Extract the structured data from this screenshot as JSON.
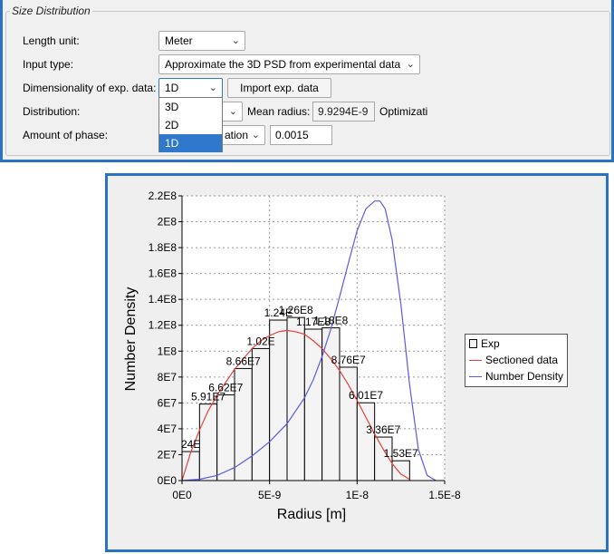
{
  "size_distribution": {
    "group_title": "Size Distribution",
    "length_unit": {
      "label": "Length unit:",
      "value": "Meter"
    },
    "input_type": {
      "label": "Input type:",
      "value": "Approximate the 3D PSD from experimental data"
    },
    "dimensionality": {
      "label": "Dimensionality of exp. data:",
      "value": "1D",
      "options": [
        "3D",
        "2D",
        "1D"
      ],
      "selected_index": 2
    },
    "import_button": "Import exp. data",
    "distribution": {
      "label": "Distribution:"
    },
    "mean_radius": {
      "label": "Mean radius:",
      "value": "9.9294E-9"
    },
    "optimization_label": "Optimizati",
    "amount_of_phase": {
      "label": "Amount of phase:",
      "mode_value": "ation",
      "value": "0.0015"
    }
  },
  "chart_data": {
    "type": "bar",
    "xlabel": "Radius [m]",
    "ylabel": "Number Density",
    "xlim": [
      0,
      1.5e-08
    ],
    "ylim": [
      0,
      220000000.0
    ],
    "x_ticks": [
      0,
      5e-09,
      1e-08,
      1.5e-08
    ],
    "x_tick_labels": [
      "0E0",
      "5E-9",
      "1E-8",
      "1.5E-8"
    ],
    "y_ticks": [
      0,
      20000000.0,
      40000000.0,
      60000000.0,
      80000000.0,
      100000000.0,
      120000000.0,
      140000000.0,
      160000000.0,
      180000000.0,
      200000000.0,
      220000000.0
    ],
    "y_tick_labels": [
      "0E0",
      "2E7",
      "4E7",
      "6E7",
      "8E7",
      "1E8",
      "1.2E8",
      "1.4E8",
      "1.6E8",
      "1.8E8",
      "2E8",
      "2.2E8"
    ],
    "grid": true,
    "legend_position": "right",
    "bars": {
      "name": "Exp",
      "bin_edges": [
        0,
        1e-09,
        2e-09,
        3e-09,
        4e-09,
        5e-09,
        6e-09,
        7e-09,
        8e-09,
        9e-09,
        1e-08,
        1.1e-08,
        1.2e-08,
        1.3e-08
      ],
      "values": [
        22400000.0,
        59100000.0,
        66200000.0,
        86600000.0,
        102000000.0,
        124000000.0,
        126000000.0,
        117000000.0,
        118000000.0,
        87600000.0,
        60100000.0,
        33600000.0,
        15300000.0
      ],
      "labels": [
        "24E",
        "5.91E7",
        "6.62E7",
        "8.66E7",
        "1.02E",
        "1.24E",
        "1.26E8",
        "1.17E8",
        "1.18E8",
        "8.76E7",
        "6.01E7",
        "3.36E7",
        "1.53E7"
      ]
    },
    "series": [
      {
        "name": "Sectioned data",
        "color": "#e8403c",
        "x": [
          0,
          5e-10,
          1e-09,
          1.5e-09,
          2e-09,
          2.5e-09,
          3e-09,
          3.5e-09,
          4e-09,
          4.5e-09,
          5e-09,
          5.5e-09,
          6e-09,
          6.5e-09,
          7e-09,
          7.5e-09,
          8e-09,
          8.5e-09,
          9e-09,
          9.5e-09,
          1e-08,
          1.05e-08,
          1.1e-08,
          1.15e-08,
          1.2e-08,
          1.25e-08,
          1.3e-08
        ],
        "y": [
          0,
          22000000.0,
          39000000.0,
          54000000.0,
          66000000.0,
          76000000.0,
          86000000.0,
          94000000.0,
          102000000.0,
          108000000.0,
          112000000.0,
          115000000.0,
          116000000.0,
          115000000.0,
          113000000.0,
          108000000.0,
          102000000.0,
          94000000.0,
          85000000.0,
          74000000.0,
          62000000.0,
          49000000.0,
          36000000.0,
          24000000.0,
          13000000.0,
          5000000.0,
          1000000.0
        ]
      },
      {
        "name": "Number Density",
        "color": "#5a5ae6",
        "x": [
          0,
          1e-09,
          2e-09,
          3e-09,
          4e-09,
          5e-09,
          6e-09,
          7e-09,
          7.5e-09,
          8e-09,
          8.5e-09,
          9e-09,
          9.5e-09,
          1e-08,
          1.05e-08,
          1.1e-08,
          1.13e-08,
          1.16e-08,
          1.2e-08,
          1.25e-08,
          1.3e-08,
          1.35e-08,
          1.4e-08,
          1.45e-08
        ],
        "y": [
          0,
          1000000.0,
          4000000.0,
          10000000.0,
          19000000.0,
          30000000.0,
          44000000.0,
          64000000.0,
          78000000.0,
          96000000.0,
          117000000.0,
          142000000.0,
          168000000.0,
          193000000.0,
          210000000.0,
          216000000.0,
          216000000.0,
          210000000.0,
          186000000.0,
          136000000.0,
          74000000.0,
          24000000.0,
          4000000.0,
          0
        ]
      }
    ]
  }
}
